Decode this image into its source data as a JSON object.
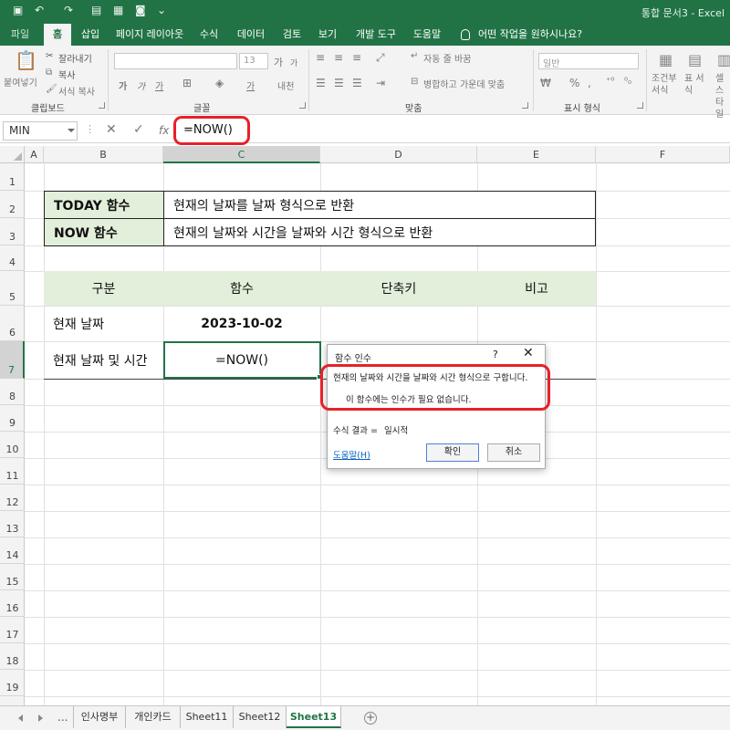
{
  "app": {
    "title": "통합 문서3 - Excel"
  },
  "ribbon": {
    "tabs": [
      {
        "label": "파일"
      },
      {
        "label": "홈"
      },
      {
        "label": "삽입"
      },
      {
        "label": "페이지 레이아웃"
      },
      {
        "label": "수식"
      },
      {
        "label": "데이터"
      },
      {
        "label": "검토"
      },
      {
        "label": "보기"
      },
      {
        "label": "개발 도구"
      },
      {
        "label": "도움말"
      },
      {
        "label": "어떤 작업을 원하시나요?"
      }
    ],
    "active_tab": "홈",
    "clipboard": {
      "paste": "붙여넣기",
      "cut": "잘라내기",
      "copy": "복사",
      "format_painter": "서식 복사",
      "label": "클립보드"
    },
    "font": {
      "size": "13",
      "grow": "가",
      "shrink": "가",
      "bold": "가",
      "italic": "가",
      "underline": "가",
      "font_color": "가",
      "phonetic": "내천",
      "label": "글꼴"
    },
    "alignment": {
      "wrap_text": "자동 줄 바꿈",
      "merge_center": "병합하고 가운데 맞춤",
      "label": "맞춤"
    },
    "number": {
      "format": "일반",
      "percent": "%",
      "comma": ",",
      "label": "표시 형식"
    },
    "styles": {
      "conditional": "조건부 서식",
      "table": "표 서식",
      "cell_styles": "셀 스타일"
    }
  },
  "formula_bar": {
    "name_box": "MIN",
    "cancel": "✕",
    "enter": "✓",
    "fx": "fx",
    "formula": "=NOW()"
  },
  "columns": [
    "A",
    "B",
    "C",
    "D",
    "E",
    "F"
  ],
  "rows": [
    "1",
    "2",
    "3",
    "4",
    "5",
    "6",
    "7",
    "8",
    "9",
    "10",
    "11",
    "12",
    "13",
    "14",
    "15",
    "16",
    "17",
    "18",
    "19"
  ],
  "sheet": {
    "today_name": "TODAY 함수",
    "today_desc": "현재의 날짜를 날짜 형식으로 반환",
    "now_name": "NOW 함수",
    "now_desc": "현재의 날짜와 시간을 날짜와 시간 형식으로 반환",
    "headers": [
      "구분",
      "함수",
      "단축키",
      "비고"
    ],
    "row_date_label": "현재 날짜",
    "row_date_value": "2023-10-02",
    "row_datetime_label": "현재 날짜 및 시간",
    "row_datetime_value": "=NOW()"
  },
  "dialog": {
    "title": "함수 인수",
    "help": "?",
    "close": "✕",
    "description": "현재의 날짜와 시간을 날짜와 시간 형식으로 구합니다.",
    "note": "이 함수에는 인수가 필요 없습니다.",
    "result_label": "수식 결과 =",
    "result_value": "일시적",
    "help_link": "도움말(H)",
    "ok": "확인",
    "cancel": "취소"
  },
  "sheet_tabs": {
    "more": "...",
    "tabs": [
      "인사명부",
      "개인카드",
      "Sheet11",
      "Sheet12",
      "Sheet13"
    ],
    "active": "Sheet13",
    "add": "+"
  },
  "colors": {
    "excel_green": "#217346",
    "header_fill": "#e2efda",
    "highlight_red": "#e8202a",
    "link_blue": "#0563c1"
  }
}
